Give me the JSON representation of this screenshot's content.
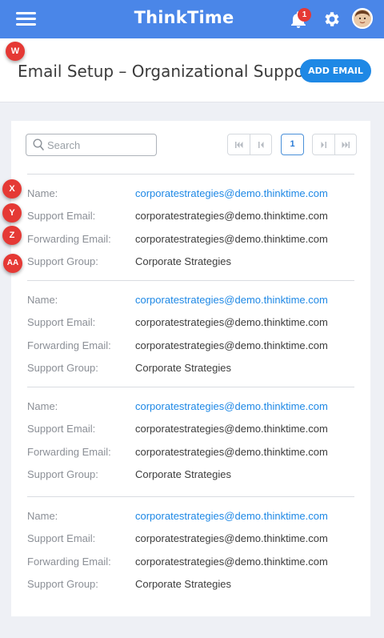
{
  "header": {
    "logo": "ThinkTime",
    "notification_count": "1"
  },
  "page": {
    "title": "Email Setup – Organizational Support",
    "add_button": "ADD EMAIL"
  },
  "search": {
    "placeholder": "Search"
  },
  "pagination": {
    "current_page": "1"
  },
  "labels": {
    "name": "Name:",
    "support_email": "Support Email:",
    "forwarding_email": "Forwarding Email:",
    "support_group": "Support Group:"
  },
  "records": [
    {
      "name": "corporatestrategies@demo.thinktime.com",
      "support_email": "corporatestrategies@demo.thinktime.com",
      "forwarding_email": "corporatestrategies@demo.thinktime.com",
      "support_group": "Corporate Strategies"
    },
    {
      "name": "corporatestrategies@demo.thinktime.com",
      "support_email": "corporatestrategies@demo.thinktime.com",
      "forwarding_email": "corporatestrategies@demo.thinktime.com",
      "support_group": "Corporate Strategies"
    },
    {
      "name": "corporatestrategies@demo.thinktime.com",
      "support_email": "corporatestrategies@demo.thinktime.com",
      "forwarding_email": "corporatestrategies@demo.thinktime.com",
      "support_group": "Corporate Strategies"
    },
    {
      "name": "corporatestrategies@demo.thinktime.com",
      "support_email": "corporatestrategies@demo.thinktime.com",
      "forwarding_email": "corporatestrategies@demo.thinktime.com",
      "support_group": "Corporate Strategies"
    }
  ],
  "markers": [
    "W",
    "X",
    "Y",
    "Z",
    "AA"
  ],
  "colors": {
    "topbar": "#4a86e8",
    "accent": "#1e88e5",
    "marker": "#e53935"
  },
  "icons": [
    "menu-icon",
    "bell-icon",
    "gear-icon",
    "avatar",
    "search-icon",
    "first-page-icon",
    "prev-page-icon",
    "next-page-icon",
    "last-page-icon"
  ]
}
